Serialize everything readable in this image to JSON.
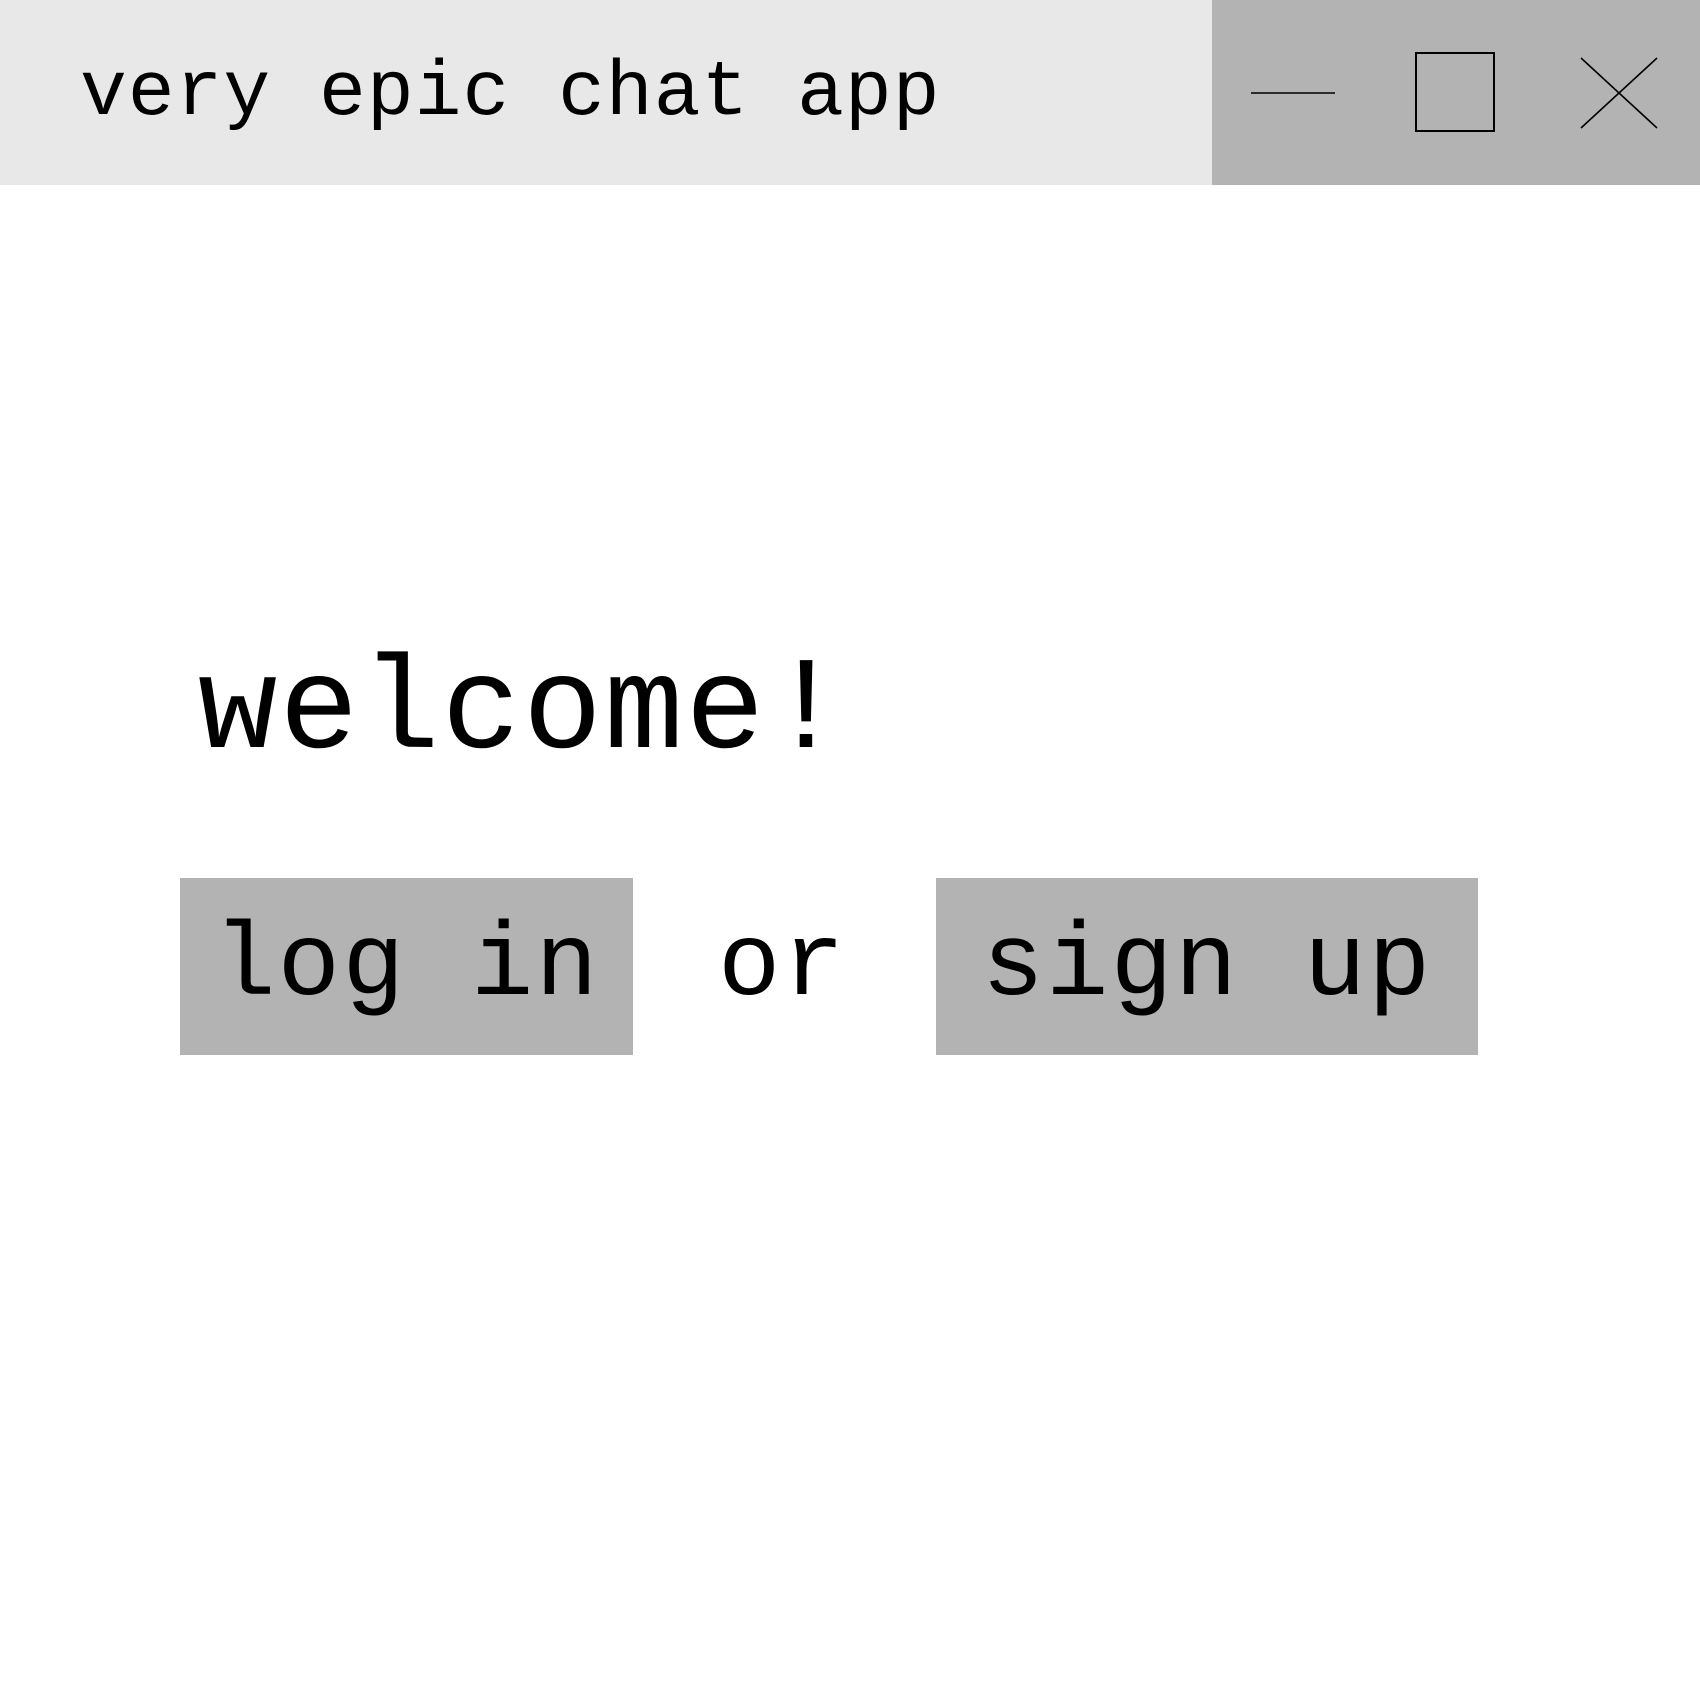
{
  "window": {
    "title": "very epic chat app",
    "controls": {
      "minimize_icon": "minimize-icon",
      "maximize_icon": "maximize-icon",
      "close_icon": "close-icon"
    }
  },
  "main": {
    "heading": "welcome!",
    "login_label": "log in",
    "separator": "or",
    "signup_label": "sign up"
  },
  "colors": {
    "titlebar_bg": "#e8e8e8",
    "controls_bg": "#b3b3b3",
    "button_bg": "#b3b3b3",
    "text": "#000000"
  }
}
